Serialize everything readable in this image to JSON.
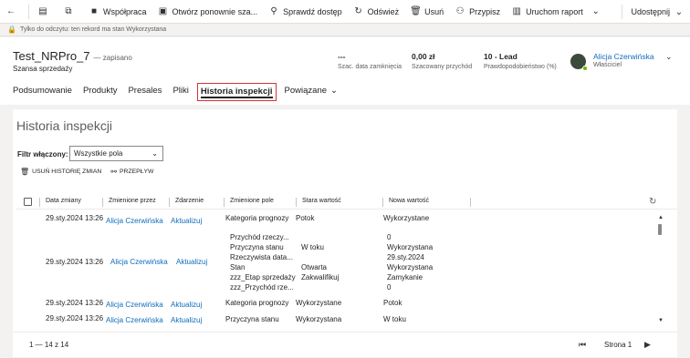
{
  "toolbar": {
    "back_icon": "back-arrow-icon",
    "items": [
      {
        "label": "",
        "icon": "document-icon"
      },
      {
        "label": "",
        "icon": "open-new-window-icon"
      },
      {
        "label": "Współpraca",
        "icon": "teams-icon"
      },
      {
        "label": "Otwórz ponownie sza...",
        "icon": "reopen-icon"
      },
      {
        "label": "Sprawdź dostęp",
        "icon": "check-access-icon"
      },
      {
        "label": "Odśwież",
        "icon": "refresh-icon"
      },
      {
        "label": "Usuń",
        "icon": "delete-icon"
      },
      {
        "label": "Przypisz",
        "icon": "assign-icon"
      },
      {
        "label": "Uruchom raport",
        "icon": "report-icon"
      }
    ],
    "share_label": "Udostępnij"
  },
  "notice": {
    "text": "Tylko do odczytu: ten rekord ma stan Wykorzystana"
  },
  "header": {
    "title": "Test_NRPro_7",
    "saved": "— zapisano",
    "entity": "Szansa sprzedaży",
    "fields": [
      {
        "value": "---",
        "label": "Szac. data zamknięcia"
      },
      {
        "value": "0,00 zł",
        "label": "Szacowany przychód"
      },
      {
        "value": "10 - Lead",
        "label": "Prawdopodobieństwo (%)"
      }
    ],
    "owner": {
      "name": "Alicja Czerwińska",
      "label": "Właściciel"
    }
  },
  "tabs": [
    "Podsumowanie",
    "Produkty",
    "Presales",
    "Pliki",
    "Historia inspekcji",
    "Powiązane"
  ],
  "audit": {
    "title": "Historia inspekcji",
    "filter_label": "Filtr włączony:",
    "filter_value": "Wszystkie pola",
    "actions": [
      "USUŃ HISTORIĘ ZMIAN",
      "PRZEPŁYW"
    ],
    "columns": [
      "Data zmiany",
      "Zmienione przez",
      "Zdarzenie",
      "Zmienione pole",
      "Stara wartość",
      "Nowa wartość"
    ],
    "rows": [
      {
        "date": "29.sty.2024 13:26",
        "by": "Alicja Czerwińska",
        "event": "Aktualizuj",
        "fields": [
          "Kategoria prognozy"
        ],
        "old": [
          "Potok"
        ],
        "new": [
          "Wykorzystane"
        ]
      },
      {
        "date": "29.sty.2024 13:26",
        "by": "Alicja Czerwińska",
        "event": "Aktualizuj",
        "fields": [
          "Przychód rzeczy...",
          "Przyczyna stanu",
          "Rzeczywista data...",
          "Stan",
          "zzz_Etap sprzedaży",
          "zzz_Przychód rze..."
        ],
        "old": [
          "",
          "W toku",
          "",
          "Otwarta",
          "Zakwalifikuj",
          ""
        ],
        "new": [
          "0",
          "Wykorzystana",
          "29.sty.2024",
          "Wykorzystana",
          "Zamykanie",
          "0"
        ]
      },
      {
        "date": "29.sty.2024 13:26",
        "by": "Alicja Czerwińska",
        "event": "Aktualizuj",
        "fields": [
          "Kategoria prognozy"
        ],
        "old": [
          "Wykorzystane"
        ],
        "new": [
          "Potok"
        ]
      },
      {
        "date": "29.sty.2024 13:26",
        "by": "Alicja Czerwińska",
        "event": "Aktualizuj",
        "fields": [
          "Przyczyna stanu"
        ],
        "old": [
          "Wykorzystana"
        ],
        "new": [
          "W toku"
        ]
      }
    ],
    "pagination": {
      "count": "1 — 14 z 14",
      "page": "Strona 1"
    }
  }
}
